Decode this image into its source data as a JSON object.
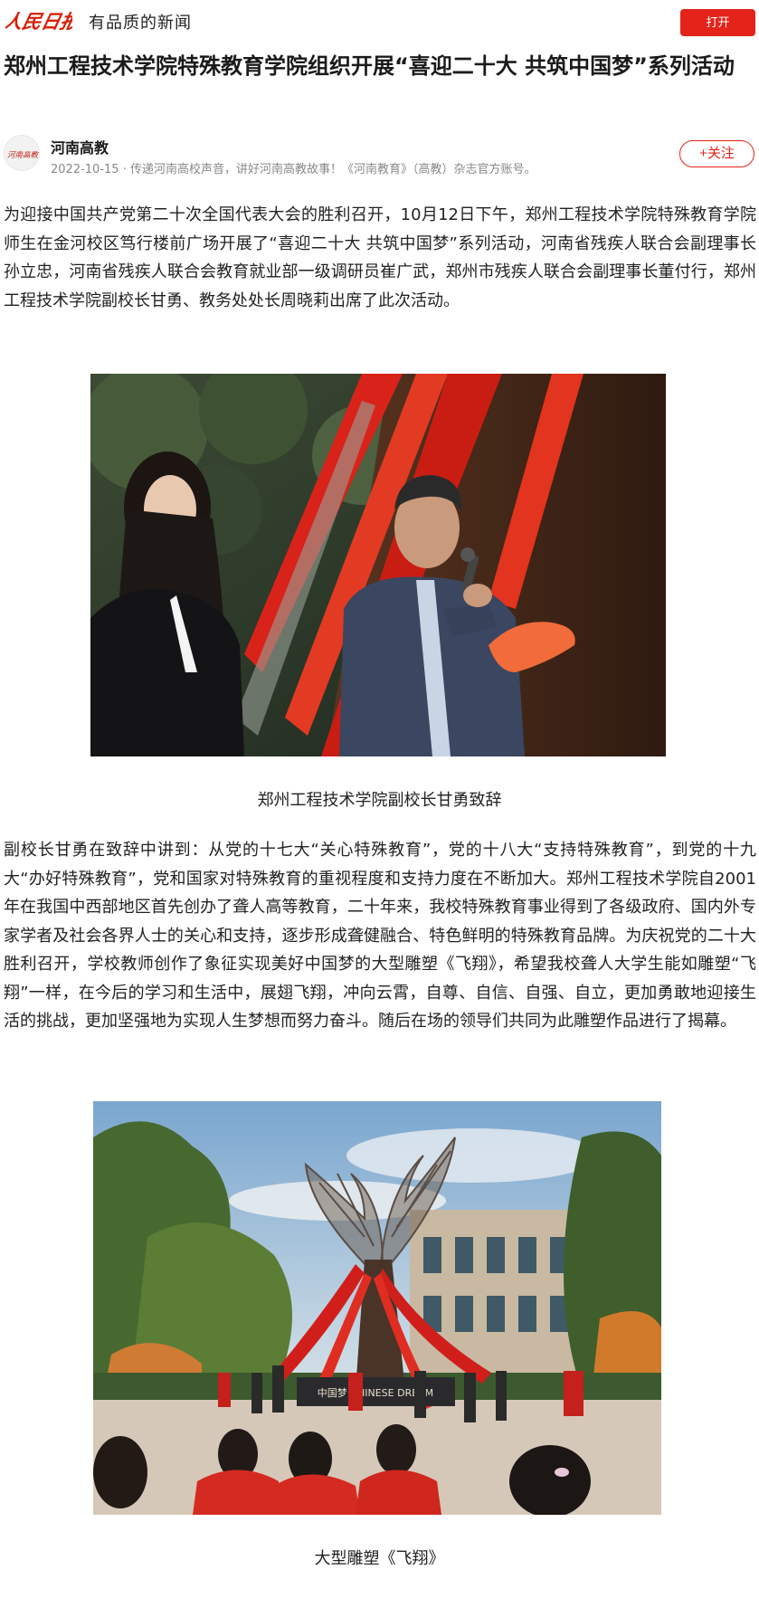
{
  "header": {
    "logo_text": "人民日报",
    "slogan": "有品质的新闻",
    "open_label": "打开",
    "brand_color": "#e4231b"
  },
  "article": {
    "title": "郑州工程技术学院特殊教育学院组织开展“喜迎二十大 共筑中国梦”系列活动",
    "author": {
      "name": "河南高教",
      "avatar_text": "河南高教",
      "date": "2022-10-15",
      "description": "传递河南高校声音，讲好河南高教故事！《河南教育》（高教）杂志官方账号。",
      "follow_label": "+关注"
    },
    "paragraphs": [
      "为迎接中国共产党第二十次全国代表大会的胜利召开，10月12日下午，郑州工程技术学院特殊教育学院师生在金河校区笃行楼前广场开展了“喜迎二十大 共筑中国梦”系列活动，河南省残疾人联合会副理事长孙立忠，河南省残疾人联合会教育就业部一级调研员崔广武，郑州市残疾人联合会副理事长董付行，郑州工程技术学院副校长甘勇、教务处处长周晓莉出席了此次活动。",
      "副校长甘勇在致辞中讲到：从党的十七大“关心特殊教育”，党的十八大“支持特殊教育”，到党的十九大“办好特殊教育”，党和国家对特殊教育的重视程度和支持力度在不断加大。郑州工程技术学院自2001年在我国中西部地区首先创办了聋人高等教育，二十年来，我校特殊教育事业得到了各级政府、国内外专家学者及社会各界人士的关心和支持，逐步形成聋健融合、特色鲜明的特殊教育品牌。为庆祝党的二十大胜利召开，学校教师创作了象征实现美好中国梦的大型雕塑《飞翔》，希望我校聋人大学生能如雕塑“飞翔”一样，在今后的学习和生活中，展翅飞翔，冲向云霄，自尊、自信、自强、自立，更加勇敢地迎接生活的挑战，更加坚强地为实现人生梦想而努力奋斗。随后在场的领导们共同为此雕塑作品进行了揭幕。"
    ],
    "photos": [
      {
        "caption": "郑州工程技术学院副校长甘勇致辞"
      },
      {
        "caption": "大型雕塑《飞翔》",
        "sign_text": "中国梦 CHINESE DREAM"
      }
    ]
  }
}
